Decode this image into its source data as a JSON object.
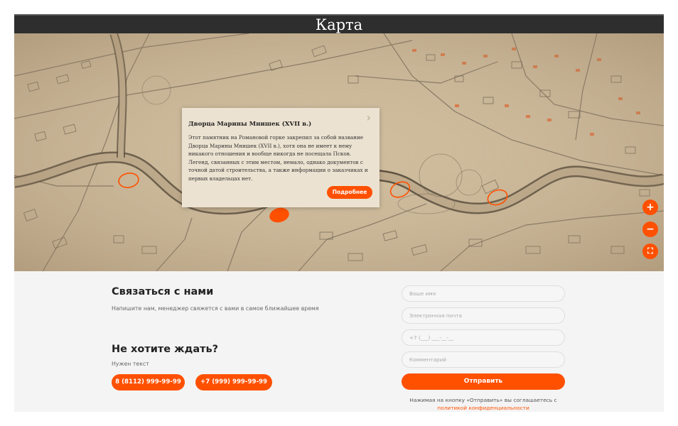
{
  "map": {
    "title": "Карта",
    "popup": {
      "title": "Дворца Марины Мнишек (XVII в.)",
      "text": "Этот памятник на Романовой горке закрепил за собой название Дворца Марины Мнишек (XVII в.), хотя она не имеет к нему никакого отношения и вообще никогда не посещала Псков. Легенд, связанных с этим местом, немало, однако документов с точной датой строительства, а также информации о заказчиках и первых владельцах нет.",
      "button": "Подробнее",
      "close_icon": "chevron-right-icon"
    },
    "controls": {
      "zoom_in": "+",
      "zoom_out": "−",
      "fullscreen": "⛶"
    }
  },
  "contact": {
    "title": "Связаться с нами",
    "subtitle": "Напишите нам, менеджер свяжется с вами в самое ближайшее время",
    "wait_title": "Не хотите ждать?",
    "wait_text": "Нужен текст",
    "phones": [
      "8 (8112) 999-99-99",
      "+7 (999) 999-99-99"
    ],
    "form": {
      "name_placeholder": "Ваше имя",
      "email_placeholder": "Электронная почта",
      "phone_placeholder": "+7 (___) ___-__-__",
      "comment_placeholder": "Комментарий",
      "submit": "Отправить",
      "consent_text": "Нажимая на кнопку «Отправить» вы соглашаетесь с",
      "consent_link": "политикой конфиденциальности"
    }
  },
  "colors": {
    "accent": "#ff5000",
    "header_bg": "#2e2e2e",
    "map_bg": "#cdb99a",
    "section_bg": "#f4f4f4"
  }
}
